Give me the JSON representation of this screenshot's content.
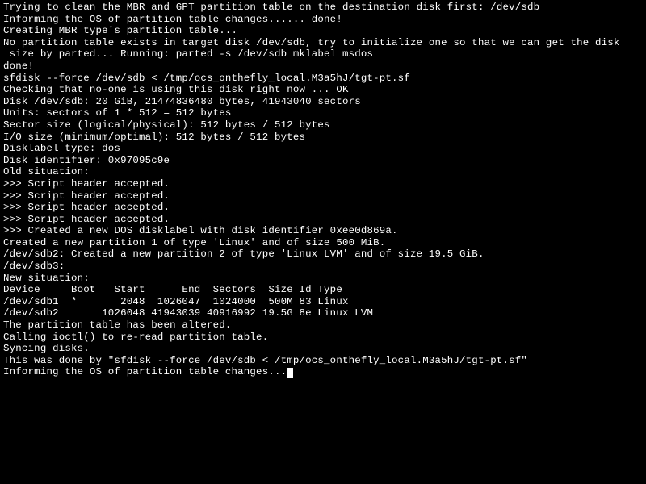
{
  "terminal": {
    "lines": [
      "Trying to clean the MBR and GPT partition table on the destination disk first: /dev/sdb",
      "Informing the OS of partition table changes...... done!",
      "Creating MBR type's partition table...",
      "No partition table exists in target disk /dev/sdb, try to initialize one so that we can get the disk",
      " size by parted... Running: parted -s /dev/sdb mklabel msdos",
      "done!",
      "sfdisk --force /dev/sdb < /tmp/ocs_onthefly_local.M3a5hJ/tgt-pt.sf",
      "Checking that no-one is using this disk right now ... OK",
      "",
      "Disk /dev/sdb: 20 GiB, 21474836480 bytes, 41943040 sectors",
      "Units: sectors of 1 * 512 = 512 bytes",
      "Sector size (logical/physical): 512 bytes / 512 bytes",
      "I/O size (minimum/optimal): 512 bytes / 512 bytes",
      "Disklabel type: dos",
      "Disk identifier: 0x97095c9e",
      "",
      "Old situation:",
      "",
      ">>> Script header accepted.",
      ">>> Script header accepted.",
      ">>> Script header accepted.",
      ">>> Script header accepted.",
      ">>> Created a new DOS disklabel with disk identifier 0xee0d869a.",
      "Created a new partition 1 of type 'Linux' and of size 500 MiB.",
      "/dev/sdb2: Created a new partition 2 of type 'Linux LVM' and of size 19.5 GiB.",
      "/dev/sdb3: ",
      "New situation:",
      "",
      "Device     Boot   Start      End  Sectors  Size Id Type",
      "/dev/sdb1  *       2048  1026047  1024000  500M 83 Linux",
      "/dev/sdb2       1026048 41943039 40916992 19.5G 8e Linux LVM",
      "",
      "The partition table has been altered.",
      "Calling ioctl() to re-read partition table.",
      "Syncing disks.",
      "This was done by \"sfdisk --force /dev/sdb < /tmp/ocs_onthefly_local.M3a5hJ/tgt-pt.sf\"",
      "Informing the OS of partition table changes..."
    ]
  }
}
